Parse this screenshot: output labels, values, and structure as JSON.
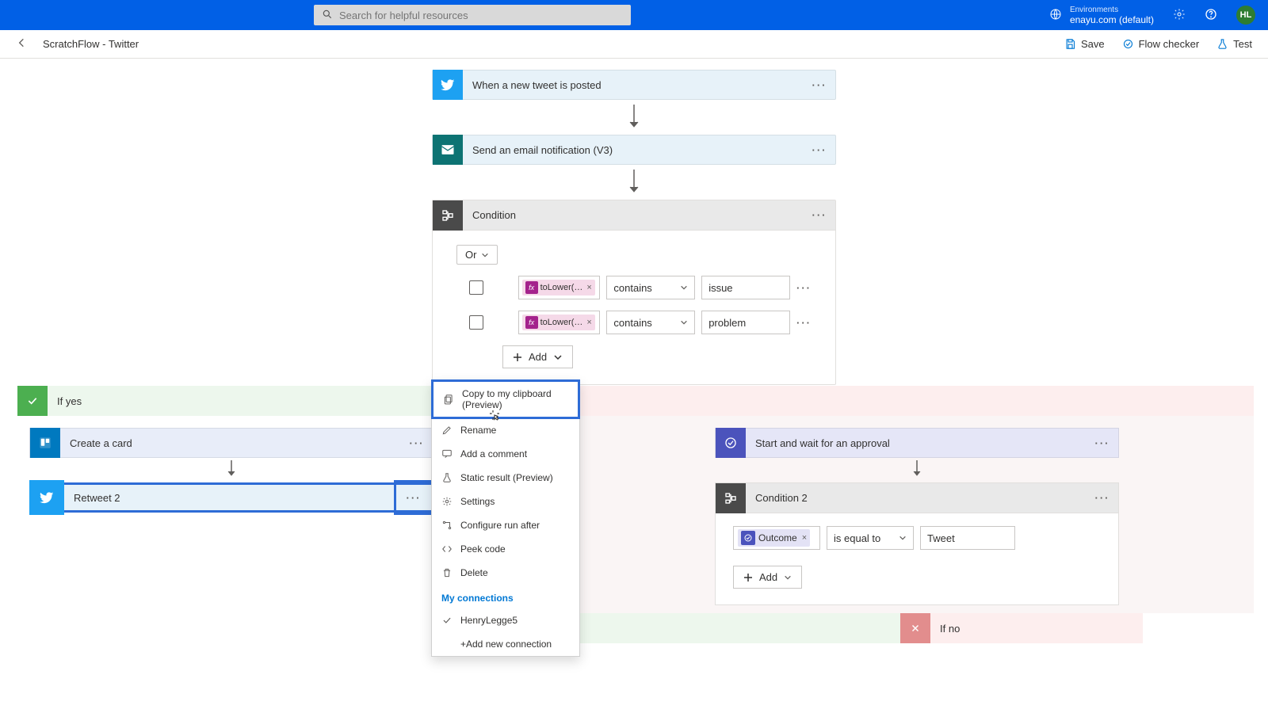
{
  "topbar": {
    "search_placeholder": "Search for helpful resources",
    "env_label": "Environments",
    "env_name": "enayu.com (default)",
    "avatar_initials": "HL"
  },
  "subbar": {
    "title": "ScratchFlow - Twitter",
    "save": "Save",
    "flow_checker": "Flow checker",
    "test": "Test"
  },
  "cards": {
    "tweet_trigger": "When a new tweet is posted",
    "email_action": "Send an email notification (V3)",
    "condition": "Condition",
    "condition2": "Condition 2",
    "create_card": "Create a card",
    "retweet": "Retweet 2",
    "approval": "Start and wait for an approval"
  },
  "condition": {
    "operator": "Or",
    "row1_token": "toLower(…",
    "row1_op": "contains",
    "row1_val": "issue",
    "row2_token": "toLower(…",
    "row2_op": "contains",
    "row2_val": "problem",
    "add": "Add"
  },
  "condition2": {
    "token": "Outcome",
    "op": "is equal to",
    "val": "Tweet",
    "add": "Add"
  },
  "branches": {
    "yes": "If yes",
    "no": "If no"
  },
  "context_menu": {
    "copy": "Copy to my clipboard (Preview)",
    "rename": "Rename",
    "comment": "Add a comment",
    "static": "Static result (Preview)",
    "settings": "Settings",
    "configure": "Configure run after",
    "peek": "Peek code",
    "delete": "Delete",
    "my_connections": "My connections",
    "conn1": "HenryLegge5",
    "add_conn": "+Add new connection"
  }
}
